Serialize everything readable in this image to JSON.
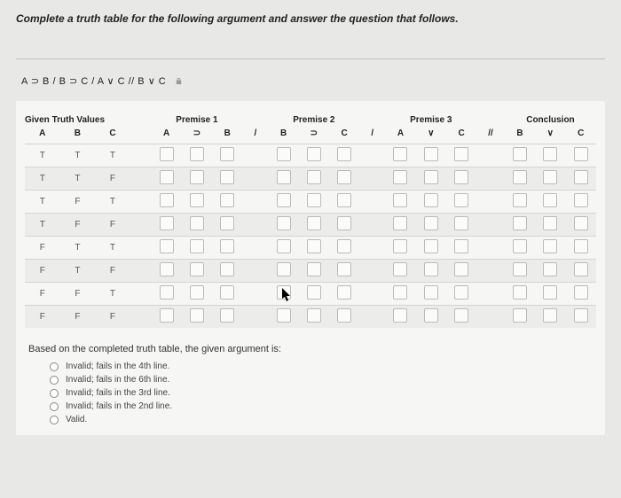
{
  "title": "Complete a truth table for the following argument and answer the question that follows.",
  "expression": "A ⊃ B / B ⊃ C / A ∨ C // B ∨ C",
  "groups": {
    "given": "Given Truth Values",
    "p1": "Premise 1",
    "p2": "Premise 2",
    "p3": "Premise 3",
    "conc": "Conclusion"
  },
  "cols": {
    "A": "A",
    "B": "B",
    "C": "C",
    "sup": "⊃",
    "or": "∨",
    "slash": "/",
    "dslash": "//"
  },
  "rows": [
    {
      "A": "T",
      "B": "T",
      "C": "T"
    },
    {
      "A": "T",
      "B": "T",
      "C": "F"
    },
    {
      "A": "T",
      "B": "F",
      "C": "T"
    },
    {
      "A": "T",
      "B": "F",
      "C": "F"
    },
    {
      "A": "F",
      "B": "T",
      "C": "T"
    },
    {
      "A": "F",
      "B": "T",
      "C": "F"
    },
    {
      "A": "F",
      "B": "F",
      "C": "T"
    },
    {
      "A": "F",
      "B": "F",
      "C": "F"
    }
  ],
  "prompt": "Based on the completed truth table, the given argument is:",
  "options": [
    "Invalid; fails in the 4th line.",
    "Invalid; fails in the 6th line.",
    "Invalid; fails in the 3rd line.",
    "Invalid; fails in the 2nd line.",
    "Valid."
  ]
}
